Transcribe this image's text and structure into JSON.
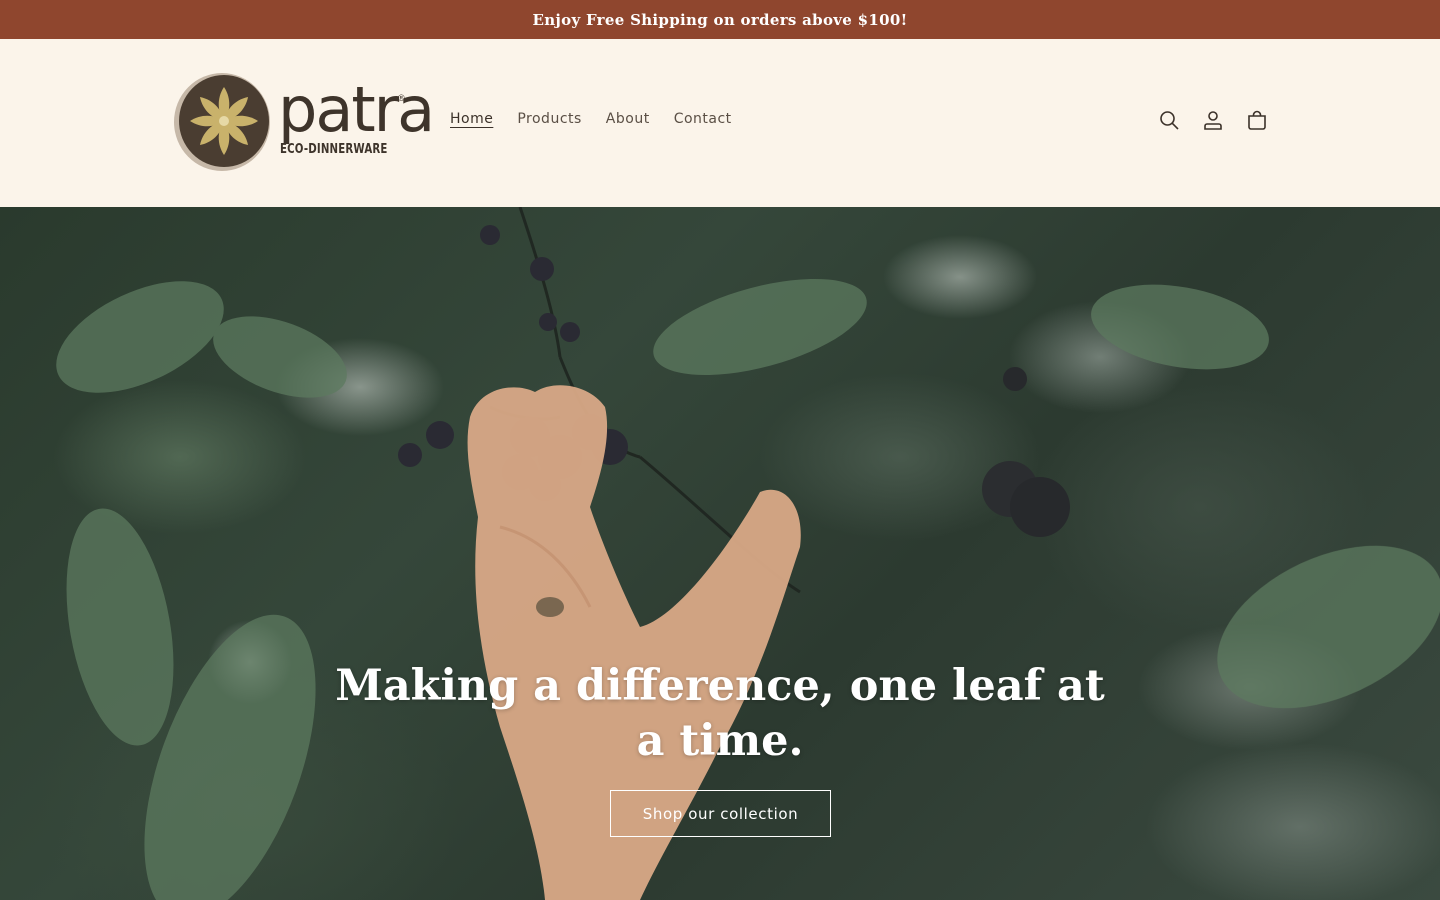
{
  "announcement": {
    "text": "Enjoy Free Shipping on orders above $100!"
  },
  "header": {
    "logo": {
      "wordmark": "patra",
      "registered": "®",
      "tagline": "ECO-DINNERWARE"
    },
    "nav": [
      {
        "label": "Home",
        "active": true
      },
      {
        "label": "Products",
        "active": false
      },
      {
        "label": "About",
        "active": false
      },
      {
        "label": "Contact",
        "active": false
      }
    ],
    "icons": [
      "search-icon",
      "account-icon",
      "cart-icon"
    ]
  },
  "hero": {
    "title": "Making a difference, one leaf at a time.",
    "button_label": "Shop our collection"
  },
  "colors": {
    "announcement_bg": "#8f462e",
    "header_bg": "#fbf4ea",
    "text_dark": "#3b3129",
    "logo_gold": "#c9b26b",
    "logo_brown": "#4a3d31"
  }
}
